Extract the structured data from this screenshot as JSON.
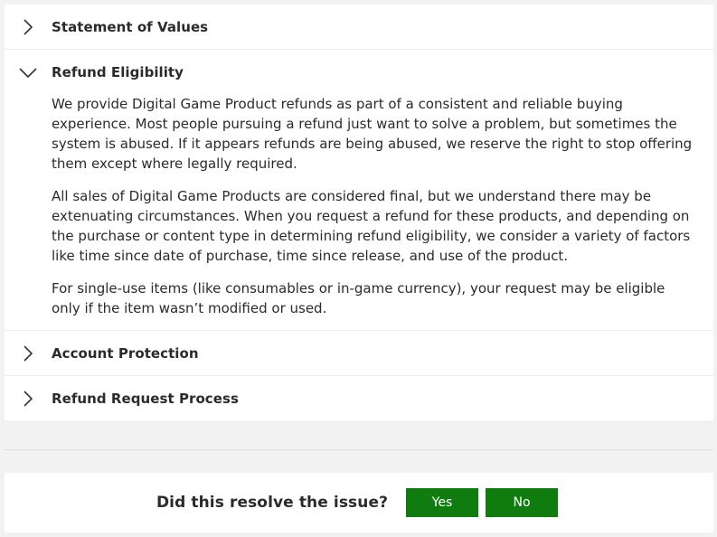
{
  "accordion": {
    "items": [
      {
        "title": "Statement of Values",
        "expanded": false
      },
      {
        "title": "Refund Eligibility",
        "expanded": true,
        "paragraphs": [
          "We provide Digital Game Product refunds as part of a consistent and reliable buying experience. Most people pursuing a refund just want to solve a problem, but sometimes the system is abused. If it appears refunds are being abused, we reserve the right to stop offering them except where legally required.",
          "All sales of Digital Game Products are considered final, but we understand there may be extenuating circumstances. When you request a refund for these products, and depending on the purchase or content type in determining refund eligibility, we consider a variety of factors like time since date of purchase, time since release, and use of the product.",
          "For single-use items (like consumables or in-game currency), your request may be eligible only if the item wasn’t modified or used."
        ]
      },
      {
        "title": "Account Protection",
        "expanded": false
      },
      {
        "title": "Refund Request Process",
        "expanded": false
      }
    ]
  },
  "feedback": {
    "question": "Did this resolve the issue?",
    "yes_label": "Yes",
    "no_label": "No"
  },
  "colors": {
    "button_green": "#107c10",
    "page_background": "#f2f2f2",
    "panel_background": "#ffffff",
    "text": "#2b2b2b"
  },
  "icons": {
    "collapsed": "chevron-right-icon",
    "expanded": "chevron-down-icon"
  }
}
